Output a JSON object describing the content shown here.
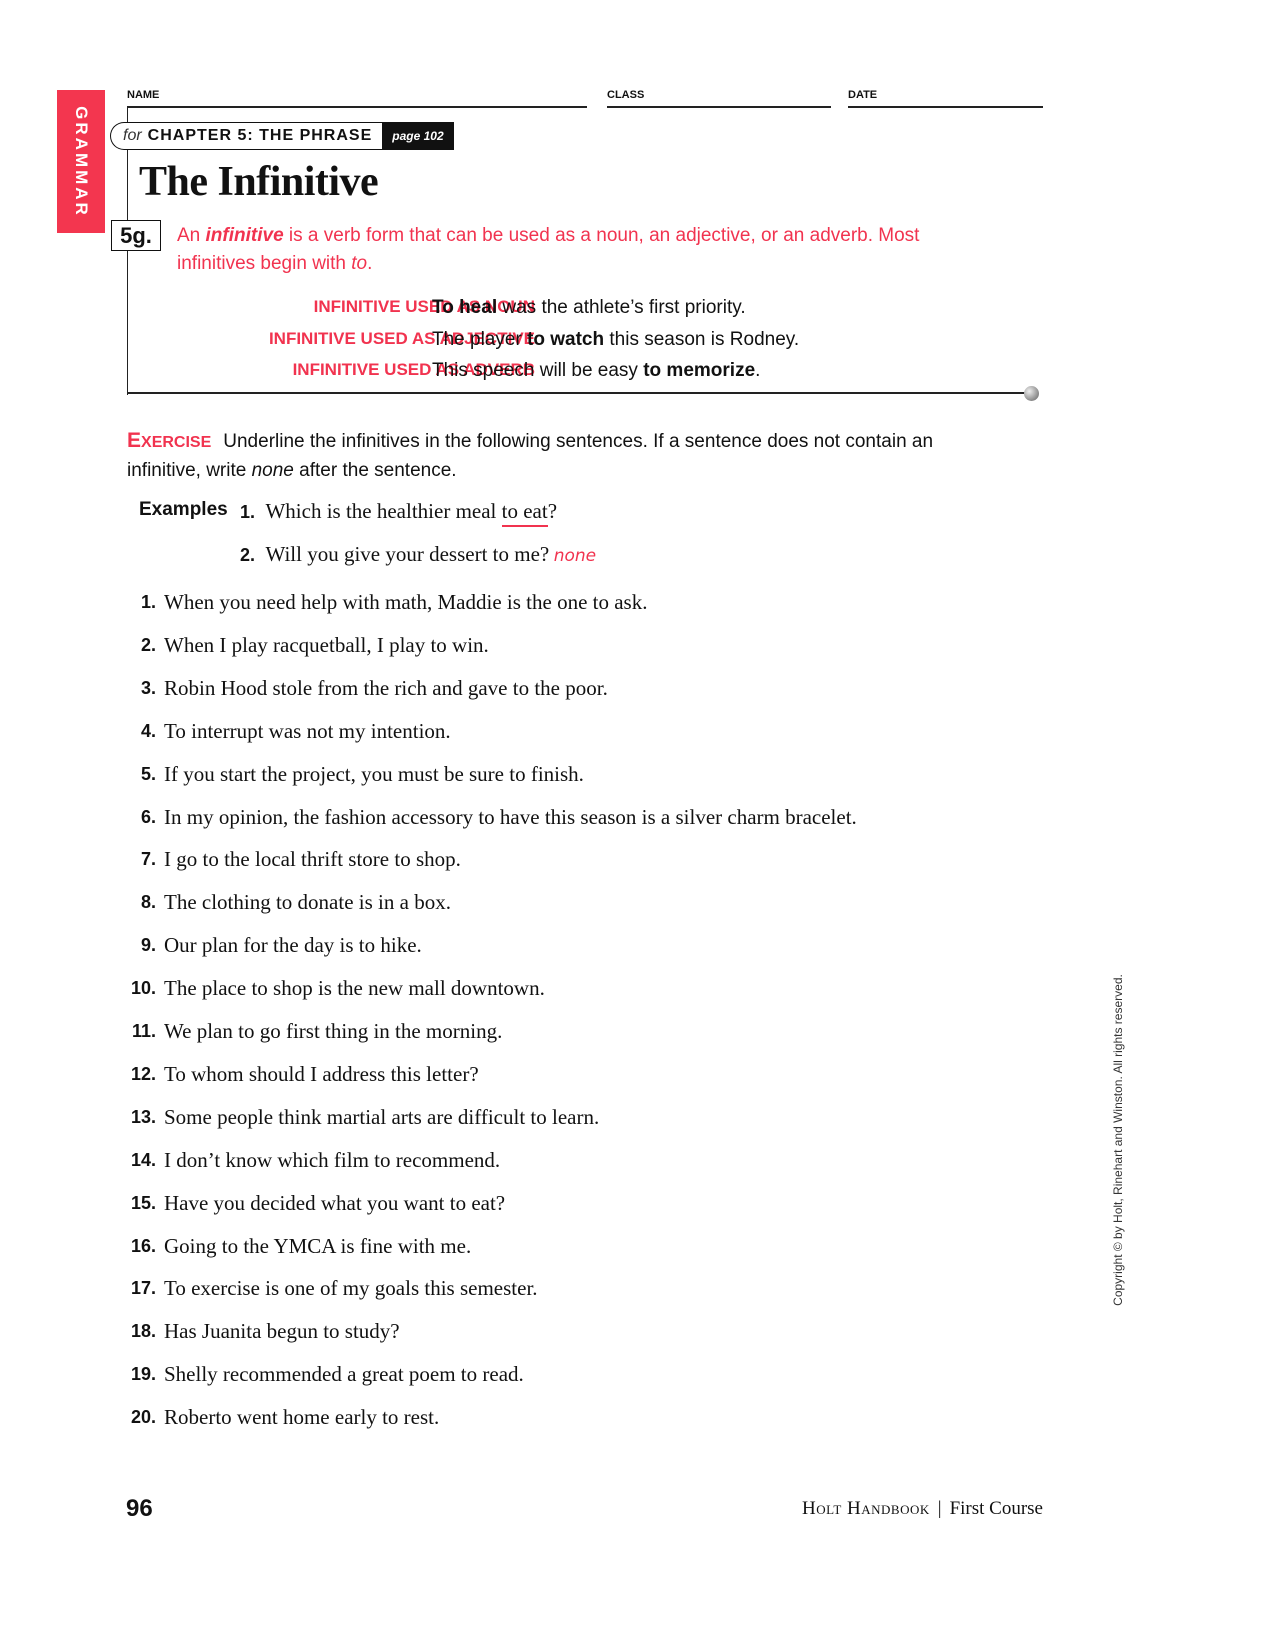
{
  "side_tab": "GRAMMAR",
  "header": {
    "name_label": "NAME",
    "class_label": "CLASS",
    "date_label": "DATE"
  },
  "chapter": {
    "for": "for",
    "title": "CHAPTER 5: THE PHRASE",
    "page_ref": "page 102"
  },
  "title": "The Infinitive",
  "rule": {
    "number": "5g.",
    "text_prefix": "An ",
    "term": "infinitive",
    "text_mid": " is a verb form that can be used as a noun, an adjective, or an adverb.  Most infinitives begin with ",
    "to_word": "to",
    "text_end": "."
  },
  "examples_table": [
    {
      "label": "INFINITIVE USED AS NOUN",
      "before": "",
      "bold": "To heal",
      "after": " was the athlete’s first priority."
    },
    {
      "label": "INFINITIVE USED AS ADJECTIVE",
      "before": "The player ",
      "bold": "to watch",
      "after": " this season is Rodney."
    },
    {
      "label": "INFINITIVE USED AS ADVERB",
      "before": "This speech will be easy ",
      "bold": "to memorize",
      "after": "."
    }
  ],
  "exercise": {
    "keyword_first": "E",
    "keyword_rest": "XERCISE",
    "instructions_a": "Underline the infinitives in the following sentences.  If a sentence does not contain an infinitive, write ",
    "none_word": "none",
    "instructions_b": " after the sentence."
  },
  "examples": {
    "label": "Examples",
    "items": [
      {
        "num": "1.",
        "before": "Which is the healthier meal ",
        "underlined": "to eat",
        "after": "?",
        "answer": ""
      },
      {
        "num": "2.",
        "before": "Will you give your dessert to me?",
        "underlined": "",
        "after": "",
        "answer": "none"
      }
    ]
  },
  "items": [
    {
      "num": "1.",
      "text": "When you need help with math, Maddie is the one to ask."
    },
    {
      "num": "2.",
      "text": "When I play racquetball, I play to win."
    },
    {
      "num": "3.",
      "text": "Robin Hood stole from the rich and gave to the poor."
    },
    {
      "num": "4.",
      "text": "To interrupt was not my intention."
    },
    {
      "num": "5.",
      "text": "If you start the project, you must be sure to finish."
    },
    {
      "num": "6.",
      "text": "In my opinion, the fashion accessory to have this season is a silver charm bracelet."
    },
    {
      "num": "7.",
      "text": "I go to the local thrift store to shop."
    },
    {
      "num": "8.",
      "text": "The clothing to donate is in a box."
    },
    {
      "num": "9.",
      "text": "Our plan for the day is to hike."
    },
    {
      "num": "10.",
      "text": "The place to shop is the new mall downtown."
    },
    {
      "num": "11.",
      "text": "We plan to go first thing in the morning."
    },
    {
      "num": "12.",
      "text": "To whom should I address this letter?"
    },
    {
      "num": "13.",
      "text": "Some people think martial arts are difficult to learn."
    },
    {
      "num": "14.",
      "text": "I don’t know which film to recommend."
    },
    {
      "num": "15.",
      "text": "Have you decided what you want to eat?"
    },
    {
      "num": "16.",
      "text": "Going to the YMCA is fine with me."
    },
    {
      "num": "17.",
      "text": "To exercise is one of my goals this semester."
    },
    {
      "num": "18.",
      "text": "Has Juanita begun to study?"
    },
    {
      "num": "19.",
      "text": "Shelly recommended a great poem to read."
    },
    {
      "num": "20.",
      "text": "Roberto went home early to rest."
    }
  ],
  "footer": {
    "page_number": "96",
    "brand": "Holt Handbook",
    "separator": "|",
    "course": "First Course"
  },
  "copyright": "Copyright © by Holt, Rinehart and Winston. All rights reserved.",
  "colors": {
    "accent_red": "#f1334f",
    "tab_red": "#f3364f"
  }
}
